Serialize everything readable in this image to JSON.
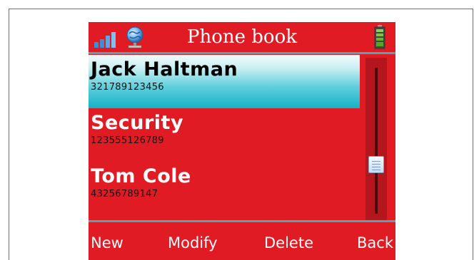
{
  "header": {
    "title": "Phone book",
    "icons": [
      "signal-strength-icon",
      "globe-network-icon",
      "battery-icon"
    ]
  },
  "contacts": [
    {
      "name": "Jack Haltman",
      "number": "321789123456",
      "selected": true
    },
    {
      "name": "Security",
      "number": "123555126789",
      "selected": false
    },
    {
      "name": "Tom Cole",
      "number": "43256789147",
      "selected": false
    }
  ],
  "softkeys": {
    "new": "New",
    "modify": "Modify",
    "delete": "Delete",
    "back": "Back"
  },
  "colors": {
    "background": "#e01b24",
    "selection": "#14b2c6",
    "divider": "#4aa6b5",
    "text": "#ffffff"
  }
}
